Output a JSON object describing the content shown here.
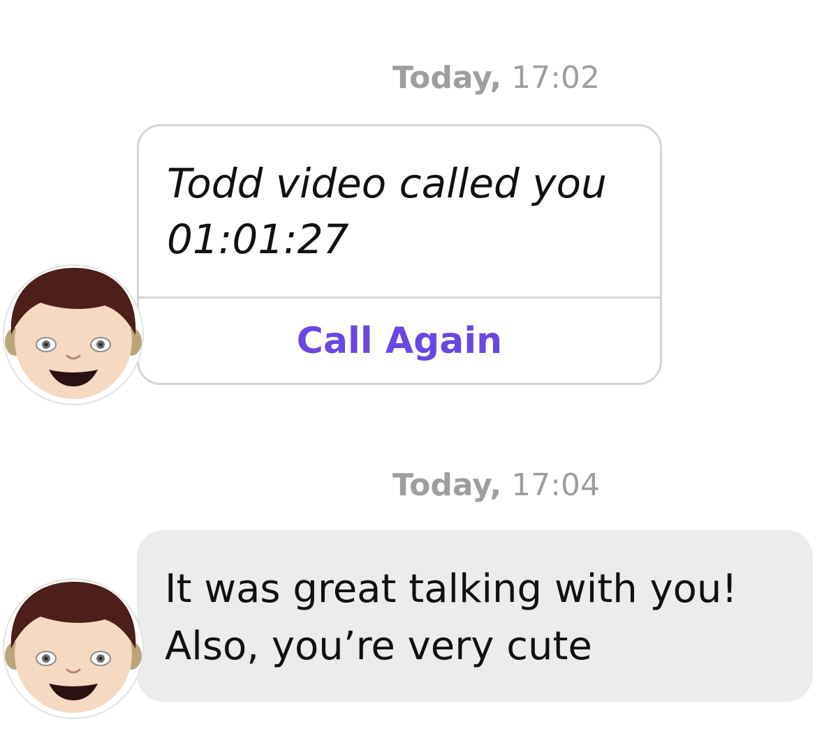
{
  "messages": [
    {
      "timestamp_day": "Today,",
      "timestamp_time": "17:02",
      "call_card": {
        "line1": "Todd video called you",
        "line2": "01:01:27",
        "action_label": "Call Again",
        "action_color": "#6a47e0"
      },
      "avatar_icon": "boy-emoji-icon"
    },
    {
      "timestamp_day": "Today,",
      "timestamp_time": "17:04",
      "text_line1": "It was great talking with you!",
      "text_line2": "Also, you’re very cute",
      "avatar_icon": "boy-emoji-icon"
    }
  ],
  "colors": {
    "timestamp": "#9e9e9e",
    "bubble_bg": "#ececec",
    "card_border": "#d4d4d4",
    "accent": "#6a47e0"
  }
}
